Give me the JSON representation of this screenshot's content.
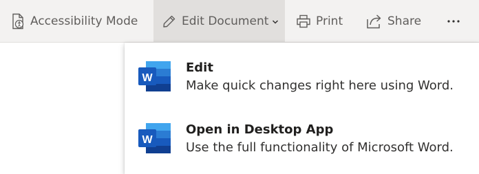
{
  "toolbar": {
    "accessibility_label": "Accessibility Mode",
    "edit_label": "Edit Document",
    "print_label": "Print",
    "share_label": "Share",
    "icons": {
      "accessibility": "accessibility-document-icon",
      "edit": "pencil-icon",
      "edit_dropdown": "chevron-down-icon",
      "print": "printer-icon",
      "share": "share-icon",
      "more": "more-ellipsis-icon"
    }
  },
  "menu": {
    "items": [
      {
        "title": "Edit",
        "description": "Make quick changes right here using Word.",
        "icon": "word-icon"
      },
      {
        "title": "Open in Desktop App",
        "description": "Use the full functionality of Microsoft Word.",
        "icon": "word-icon"
      }
    ]
  },
  "colors": {
    "toolbar_bg": "#f3f2f1",
    "active_bg": "#e1dfdd",
    "word_blue_dark": "#185abd",
    "word_blue_light": "#41a5ee"
  }
}
